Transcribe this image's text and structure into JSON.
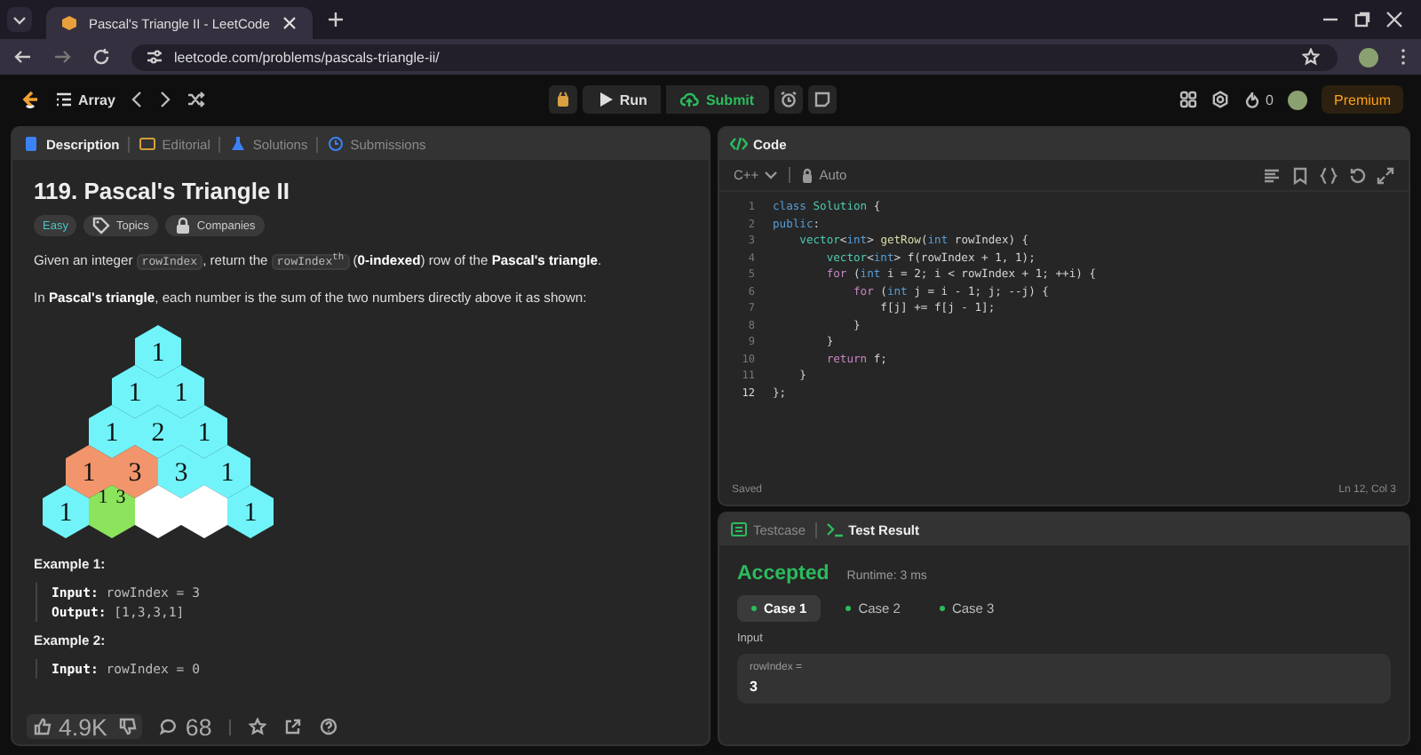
{
  "browser": {
    "tab_title": "Pascal's Triangle II - LeetCode",
    "url": "leetcode.com/problems/pascals-triangle-ii/"
  },
  "nav": {
    "problem_list": "Array",
    "run": "Run",
    "submit": "Submit",
    "streak": "0",
    "premium": "Premium"
  },
  "left_tabs": [
    {
      "label": "Description",
      "selected": true,
      "kind": "description"
    },
    {
      "label": "Editorial",
      "selected": false,
      "kind": "editorial"
    },
    {
      "label": "Solutions",
      "selected": false,
      "kind": "solutions"
    },
    {
      "label": "Submissions",
      "selected": false,
      "kind": "submissions"
    }
  ],
  "problem": {
    "title": "119. Pascal's Triangle II",
    "tags": [
      {
        "label": "Easy",
        "kind": "difficulty"
      },
      {
        "label": "Topics",
        "kind": "topics"
      },
      {
        "label": "Companies",
        "kind": "companies"
      }
    ],
    "paragraphs": [
      [
        {
          "kind": "text",
          "t": "Given an integer "
        },
        {
          "kind": "code",
          "t": "rowIndex"
        },
        {
          "kind": "text",
          "t": ", return the "
        },
        {
          "kind": "code",
          "t": "rowIndex$^{th}$"
        },
        {
          "kind": "text",
          "t": " (**0-indexed**) row of the **Pascal's triangle**."
        }
      ],
      [
        {
          "kind": "text",
          "t": "In **Pascal's triangle**, each number is the sum of the two numbers directly above it as shown:"
        }
      ]
    ],
    "triangle": [
      [
        {
          "value": "1",
          "color": "#70f4fa"
        }
      ],
      [
        {
          "value": "1",
          "color": "#70f4fa"
        },
        {
          "value": "1",
          "color": "#70f4fa"
        }
      ],
      [
        {
          "value": "1",
          "color": "#70f4fa"
        },
        {
          "value": "2",
          "color": "#70f4fa"
        },
        {
          "value": "1",
          "color": "#70f4fa"
        }
      ],
      [
        {
          "value": "1",
          "color": "#f2956c"
        },
        {
          "value": "3",
          "color": "#f2956c"
        },
        {
          "value": "3",
          "color": "#70f4fa"
        },
        {
          "value": "1",
          "color": "#70f4fa"
        }
      ],
      [
        {
          "value": "1",
          "color": "#70f4fa"
        },
        {
          "marks": [
            "1",
            "3"
          ],
          "color": "#8be45c"
        },
        {
          "color": "#ffffff"
        },
        {
          "color": "#ffffff"
        },
        {
          "value": "1",
          "color": "#70f4fa"
        }
      ]
    ],
    "examples": [
      {
        "title": "Example 1:",
        "lines": [
          "**Input:** rowIndex = 3",
          "**Output:** [1,3,3,1]"
        ]
      },
      {
        "title": "Example 2:",
        "lines": [
          "**Input:** rowIndex = 0"
        ]
      }
    ]
  },
  "footer": {
    "likes": "4.9K",
    "comments": "68"
  },
  "code_panel": {
    "title": "Code",
    "language": "C++",
    "mode": "Auto",
    "lines": [
      {
        "n": "1",
        "tokens": [
          {
            "kind": "kw",
            "text": "class"
          },
          {
            "kind": "type",
            "text": " Solution"
          },
          {
            "kind": "pl",
            "text": " {"
          }
        ]
      },
      {
        "n": "2",
        "tokens": [
          {
            "kind": "kw",
            "text": "public"
          },
          {
            "kind": "pl",
            "text": ":"
          }
        ]
      },
      {
        "n": "3",
        "tokens": [
          {
            "kind": "type",
            "text": "    vector"
          },
          {
            "kind": "pl",
            "text": "<"
          },
          {
            "kind": "kw",
            "text": "int"
          },
          {
            "kind": "pl",
            "text": "> "
          },
          {
            "kind": "fn",
            "text": "getRow"
          },
          {
            "kind": "pl",
            "text": "("
          },
          {
            "kind": "kw",
            "text": "int"
          },
          {
            "kind": "pl",
            "text": " rowIndex) {"
          }
        ]
      },
      {
        "n": "4",
        "tokens": [
          {
            "kind": "type",
            "text": "        vector"
          },
          {
            "kind": "pl",
            "text": "<"
          },
          {
            "kind": "kw",
            "text": "int"
          },
          {
            "kind": "pl",
            "text": "> f(rowIndex + 1, 1);"
          }
        ]
      },
      {
        "n": "5",
        "tokens": [
          {
            "kind": "ctl",
            "text": "        for"
          },
          {
            "kind": "pl",
            "text": " ("
          },
          {
            "kind": "kw",
            "text": "int"
          },
          {
            "kind": "pl",
            "text": " i = 2; i < rowIndex + 1; ++i) {"
          }
        ]
      },
      {
        "n": "6",
        "tokens": [
          {
            "kind": "ctl",
            "text": "            for"
          },
          {
            "kind": "pl",
            "text": " ("
          },
          {
            "kind": "kw",
            "text": "int"
          },
          {
            "kind": "pl",
            "text": " j = i - 1; j; --j) {"
          }
        ]
      },
      {
        "n": "7",
        "tokens": [
          {
            "kind": "pl",
            "text": "                f[j] += f[j - 1];"
          }
        ]
      },
      {
        "n": "8",
        "tokens": [
          {
            "kind": "pl",
            "text": "            }"
          }
        ]
      },
      {
        "n": "9",
        "tokens": [
          {
            "kind": "pl",
            "text": "        }"
          }
        ]
      },
      {
        "n": "10",
        "tokens": [
          {
            "kind": "ctl",
            "text": "        return"
          },
          {
            "kind": "pl",
            "text": " f;"
          }
        ]
      },
      {
        "n": "11",
        "tokens": [
          {
            "kind": "pl",
            "text": "    }"
          }
        ]
      },
      {
        "n": "12",
        "tokens": [
          {
            "kind": "pl",
            "text": "};"
          }
        ]
      }
    ],
    "status": "Saved",
    "cursor": "Ln 12, Col 3"
  },
  "result_panel": {
    "tabs": [
      {
        "label": "Testcase",
        "selected": false,
        "kind": "testcase"
      },
      {
        "label": "Test Result",
        "selected": true,
        "kind": "result"
      }
    ],
    "verdict": "Accepted",
    "runtime": "Runtime: 3 ms",
    "cases": [
      {
        "label": "Case 1",
        "selected": true
      },
      {
        "label": "Case 2",
        "selected": false
      },
      {
        "label": "Case 3",
        "selected": false
      }
    ],
    "input_label": "Input",
    "param_name": "rowIndex =",
    "param_value": "3"
  }
}
